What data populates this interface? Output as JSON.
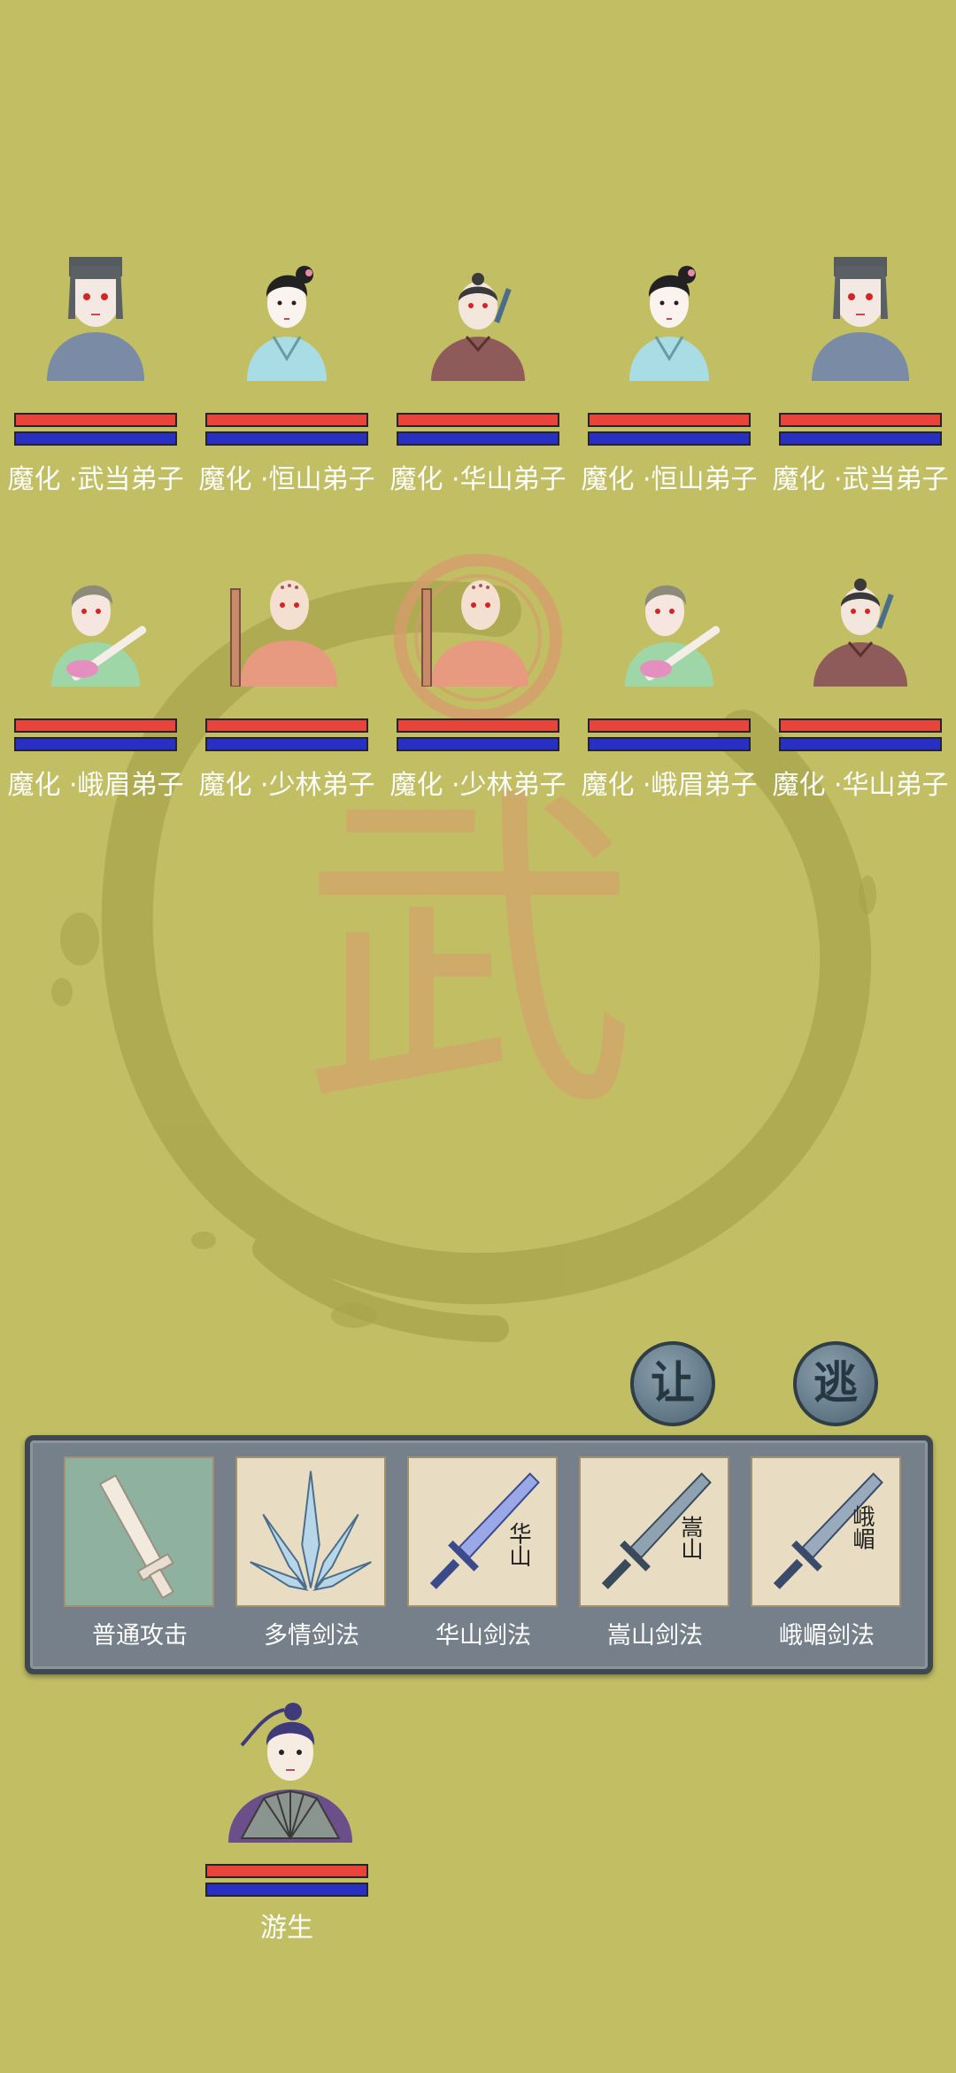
{
  "enemies_row1": [
    {
      "name": "魔化 ·武当弟子",
      "portrait": "wudang-disciple-portrait",
      "hp": 1.0,
      "mp": 1.0
    },
    {
      "name": "魔化 ·恒山弟子",
      "portrait": "hengshan-disciple-portrait",
      "hp": 1.0,
      "mp": 1.0
    },
    {
      "name": "魔化 ·华山弟子",
      "portrait": "huashan-disciple-portrait",
      "hp": 1.0,
      "mp": 1.0
    },
    {
      "name": "魔化 ·恒山弟子",
      "portrait": "hengshan-disciple-portrait",
      "hp": 1.0,
      "mp": 1.0
    },
    {
      "name": "魔化 ·武当弟子",
      "portrait": "wudang-disciple-portrait",
      "hp": 1.0,
      "mp": 1.0
    }
  ],
  "enemies_row2": [
    {
      "name": "魔化 ·峨眉弟子",
      "portrait": "emei-disciple-portrait",
      "hp": 1.0,
      "mp": 1.0
    },
    {
      "name": "魔化 ·少林弟子",
      "portrait": "shaolin-disciple-portrait",
      "hp": 1.0,
      "mp": 1.0
    },
    {
      "name": "魔化 ·少林弟子",
      "portrait": "shaolin-disciple-portrait",
      "hp": 1.0,
      "mp": 1.0
    },
    {
      "name": "魔化 ·峨眉弟子",
      "portrait": "emei-disciple-portrait",
      "hp": 1.0,
      "mp": 1.0
    },
    {
      "name": "魔化 ·华山弟子",
      "portrait": "huashan-disciple-portrait",
      "hp": 1.0,
      "mp": 1.0
    }
  ],
  "actions": {
    "yield_label": "让",
    "flee_label": "逃"
  },
  "skills": [
    {
      "label": "普通攻击",
      "icon": "basic-sword-icon",
      "glyph": ""
    },
    {
      "label": "多情剑法",
      "icon": "multi-blade-icon",
      "glyph": ""
    },
    {
      "label": "华山剑法",
      "icon": "huashan-sword-icon",
      "glyph": "华山"
    },
    {
      "label": "嵩山剑法",
      "icon": "songshan-sword-icon",
      "glyph": "嵩山"
    },
    {
      "label": "峨嵋剑法",
      "icon": "emei-sword-icon",
      "glyph": "峨嵋"
    }
  ],
  "player": {
    "name": "游生",
    "portrait": "youth-with-fan-portrait",
    "hp": 1.0,
    "mp": 1.0
  },
  "background": {
    "emblem_glyph": "武",
    "base_color": "#c2be63",
    "ink_color": "#a9a64e",
    "seal_color": "#d99a6a"
  }
}
